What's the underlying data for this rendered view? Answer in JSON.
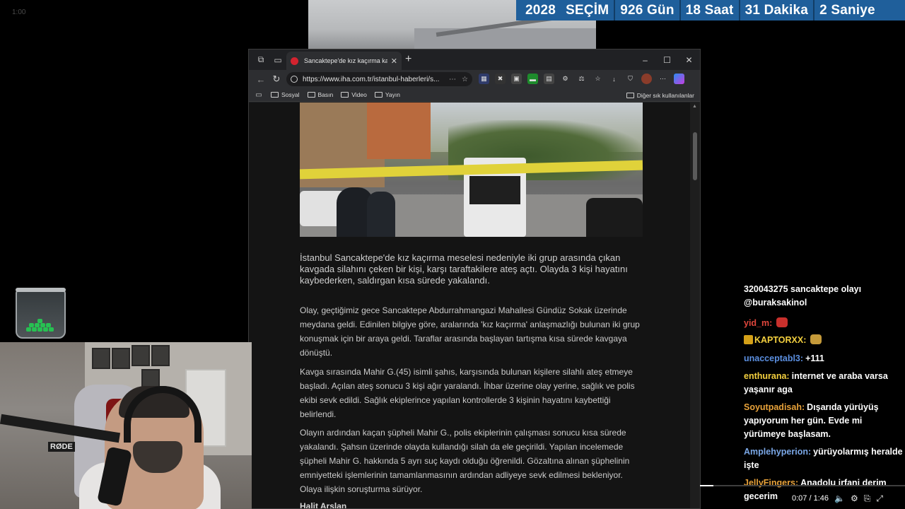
{
  "stream": {
    "corner_time": "1:00"
  },
  "countdown": {
    "year": "2028",
    "label": "SEÇİM",
    "days": "926 Gün",
    "hours": "18 Saat",
    "minutes": "31 Dakika",
    "seconds": "2 Saniye"
  },
  "browser": {
    "tab_title": "Sancaktepe'de kız kaçırma kavga",
    "url": "https://www.iha.com.tr/istanbul-haberleri/s...",
    "bookmarks": [
      "Sosyal",
      "Basın",
      "Video",
      "Yayın"
    ],
    "bookmarks_right": "Diğer sık kullanılanlar"
  },
  "article": {
    "lead": " İstanbul Sancaktepe'de kız kaçırma meselesi nedeniyle iki grup arasında çıkan kavgada silahını çeken bir kişi, karşı taraftakilere ateş açtı. Olayda 3 kişi hayatını kaybederken, saldırgan kısa sürede yakalandı.",
    "paragraphs": [
      "Olay, geçtiğimiz gece Sancaktepe Abdurrahmangazi Mahallesi Gündüz Sokak üzerinde meydana geldi. Edinilen bilgiye göre, aralarında 'kız kaçırma' anlaşmazlığı bulunan iki grup konuşmak için bir araya geldi. Taraflar arasında başlayan tartışma kısa sürede kavgaya dönüştü.",
      "Kavga sırasında Mahir G.(45) isimli şahıs, karşısında bulunan kişilere silahlı ateş etmeye başladı. Açılan ateş sonucu 3 kişi ağır yaralandı. İhbar üzerine olay yerine, sağlık ve polis ekibi sevk edildi. Sağlık ekiplerince yapılan kontrollerde 3 kişinin hayatını kaybettiği belirlendi.",
      "Olayın ardından kaçan şüpheli Mahir G., polis ekiplerinin çalışması sonucu kısa sürede yakalandı. Şahsın üzerinde olayda kullandığı silah da ele geçirildi. Yapılan incelemede şüpheli Mahir G. hakkında 5 ayrı suç kaydı olduğu öğrenildi. Gözaltına alınan şüphelinin emniyetteki işlemlerinin tamamlanmasının ardından adliyeye sevk edilmesi bekleniyor. Olaya ilişkin soruşturma sürüyor."
    ],
    "author": "Halit Arslan"
  },
  "webcam": {
    "mic_brand": "RØDE"
  },
  "chat": {
    "messages": [
      {
        "user": "",
        "text": "320043275 sancaktepe olayı @buraksakinol",
        "color": "#ffffff"
      },
      {
        "user": "yid_m:",
        "text": "",
        "color": "#e0463c",
        "emote": "#c9302c"
      },
      {
        "user": "KAPTORXX:",
        "text": "",
        "color": "#f4d03f",
        "emote": "#c59a3a",
        "badge": true
      },
      {
        "user": "unacceptabl3:",
        "text": "+111",
        "color": "#5b8fe0"
      },
      {
        "user": "enthurana:",
        "text": "internet ve araba varsa yaşanır aga",
        "color": "#f4d03f"
      },
      {
        "user": "Soyutpadisah:",
        "text": "Dışarıda yürüyüş yapıyorum her gün. Evde mi yürümeye başlasam.",
        "color": "#e8a23a"
      },
      {
        "user": "Amplehyperion:",
        "text": "yürüyolarmış heralde işte",
        "color": "#7aa7e6"
      },
      {
        "user": "JellyFingers:",
        "text": "Anadolu irfani derim gecerim",
        "color": "#e8a23a"
      }
    ]
  },
  "player": {
    "time": "0:07 / 1:46",
    "progress": 0.066
  }
}
